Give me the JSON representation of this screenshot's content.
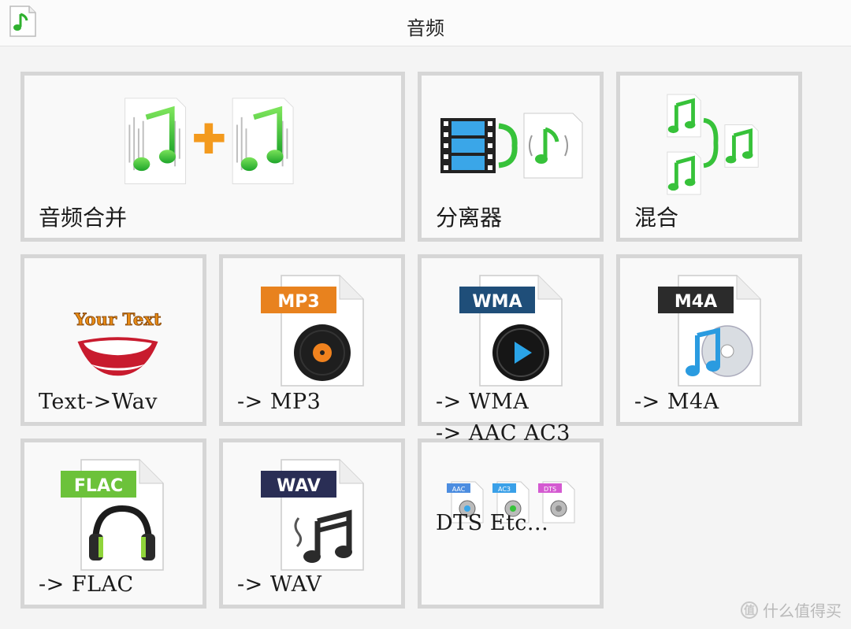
{
  "window": {
    "title": "音频"
  },
  "tiles": {
    "merge": {
      "label": "音频合并"
    },
    "splitter": {
      "label": "分离器"
    },
    "mix": {
      "label": "混合"
    },
    "text_wav": {
      "label": "Text->Wav",
      "art_text": "Your Text"
    },
    "mp3": {
      "label": "-> MP3",
      "badge": "MP3"
    },
    "wma": {
      "label": "-> WMA",
      "badge": "WMA"
    },
    "m4a": {
      "label": "-> M4A",
      "badge": "M4A"
    },
    "flac": {
      "label": "-> FLAC",
      "badge": "FLAC"
    },
    "wav": {
      "label": "-> WAV",
      "badge": "WAV"
    },
    "other": {
      "label_line1": "-> AAC AC3",
      "label_line2": "DTS Etc...",
      "badges": [
        "AAC",
        "AC3",
        "DTS"
      ]
    }
  },
  "watermark": {
    "text": "什么值得买",
    "mark": "值"
  },
  "colors": {
    "mp3_badge": "#e8821e",
    "wma_badge": "#1f4e79",
    "m4a_badge": "#2b2b2b",
    "flac_badge": "#6cc23a",
    "wav_badge": "#2a2e55",
    "note_green": "#37c23a",
    "plus_orange": "#f39a1e"
  }
}
